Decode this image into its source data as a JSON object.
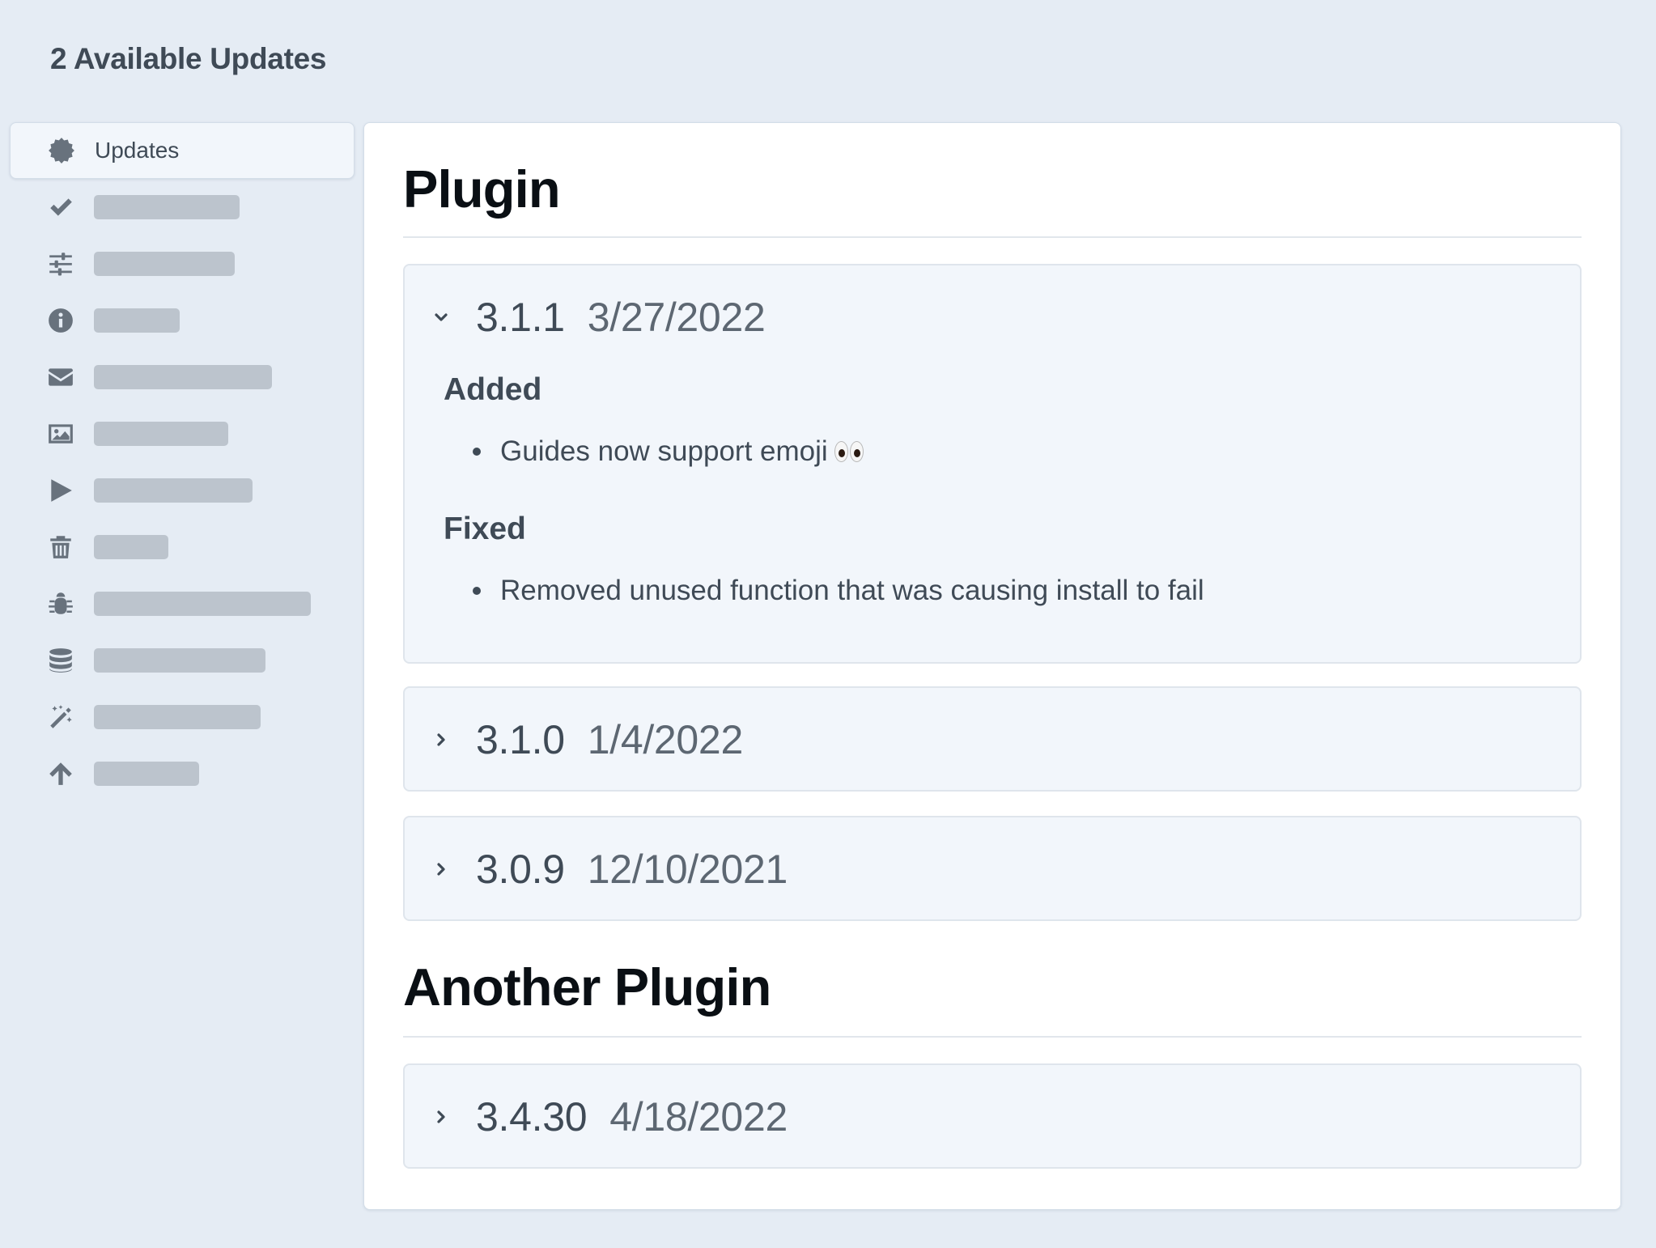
{
  "header": {
    "title": "2 Available Updates"
  },
  "sidebar": {
    "items": [
      {
        "icon": "badge-icon",
        "label": "Updates",
        "active": true
      },
      {
        "icon": "check-icon",
        "label": null
      },
      {
        "icon": "sliders-icon",
        "label": null
      },
      {
        "icon": "info-icon",
        "label": null
      },
      {
        "icon": "envelope-icon",
        "label": null
      },
      {
        "icon": "image-icon",
        "label": null
      },
      {
        "icon": "play-icon",
        "label": null
      },
      {
        "icon": "trash-icon",
        "label": null
      },
      {
        "icon": "bug-icon",
        "label": null
      },
      {
        "icon": "database-icon",
        "label": null
      },
      {
        "icon": "magic-wand-icon",
        "label": null
      },
      {
        "icon": "arrow-up-icon",
        "label": null
      }
    ]
  },
  "plugins": [
    {
      "name": "Plugin",
      "releases": [
        {
          "version": "3.1.1",
          "date": "3/27/2022",
          "expanded": true,
          "changes": [
            {
              "heading": "Added",
              "items": [
                "Guides now support emoji"
              ]
            },
            {
              "heading": "Fixed",
              "items": [
                "Removed unused function that was causing install to fail"
              ]
            }
          ]
        },
        {
          "version": "3.1.0",
          "date": "1/4/2022",
          "expanded": false
        },
        {
          "version": "3.0.9",
          "date": "12/10/2021",
          "expanded": false
        }
      ]
    },
    {
      "name": "Another Plugin",
      "releases": [
        {
          "version": "3.4.30",
          "date": "4/18/2022",
          "expanded": false
        }
      ]
    }
  ]
}
